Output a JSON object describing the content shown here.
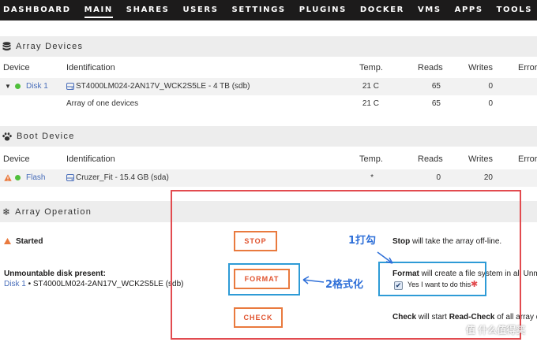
{
  "nav": {
    "items": [
      "DASHBOARD",
      "MAIN",
      "SHARES",
      "USERS",
      "SETTINGS",
      "PLUGINS",
      "DOCKER",
      "VMS",
      "APPS",
      "TOOLS"
    ],
    "active": "MAIN"
  },
  "array_devices": {
    "title": "Array Devices",
    "headers": {
      "device": "Device",
      "identification": "Identification",
      "temp": "Temp.",
      "reads": "Reads",
      "writes": "Writes",
      "errors": "Errors"
    },
    "rows": [
      {
        "device": "Disk 1",
        "identification": "ST4000LM024-2AN17V_WCK2S5LE - 4 TB (sdb)",
        "temp": "21 C",
        "reads": "65",
        "writes": "0"
      },
      {
        "device": "",
        "identification": "Array of one devices",
        "temp": "21 C",
        "reads": "65",
        "writes": "0"
      }
    ]
  },
  "boot_device": {
    "title": "Boot Device",
    "headers": {
      "device": "Device",
      "identification": "Identification",
      "temp": "Temp.",
      "reads": "Reads",
      "writes": "Writes",
      "errors": "Errors"
    },
    "rows": [
      {
        "device": "Flash",
        "identification": "Cruzer_Fit - 15.4 GB (sda)",
        "temp": "*",
        "reads": "0",
        "writes": "20"
      }
    ]
  },
  "array_operation": {
    "title": "Array Operation",
    "status": "Started",
    "stop": {
      "label": "STOP",
      "strong": "Stop",
      "desc": " will take the array off-line."
    },
    "unmountable": {
      "heading": "Unmountable disk present:",
      "disk_link": "Disk 1",
      "disk_rest": " • ST4000LM024-2AN17V_WCK2S5LE (sdb)"
    },
    "format": {
      "label": "FORMAT",
      "strong": "Format",
      "desc": " will create a file system in all Unmountable",
      "confirm_label": "Yes I want to do this",
      "confirm_checked": true
    },
    "check": {
      "label": "CHECK",
      "strong": "Check",
      "desc_mid": " will start ",
      "strong2": "Read-Check",
      "desc_end": " of all array disks"
    }
  },
  "annotations": {
    "check_hint": "1打勾",
    "format_hint": "2格式化"
  },
  "watermark": "值 什么值得买",
  "colors": {
    "accent": "#e97a3e",
    "annotation_red": "#e24b4f",
    "annotation_blue": "#2e9bd6",
    "link": "#486dba",
    "status_green": "#4fbf3b"
  }
}
